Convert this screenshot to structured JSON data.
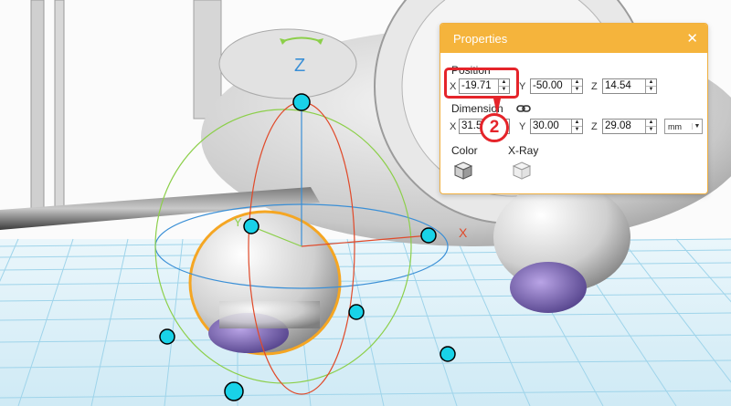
{
  "viewport": {
    "axis_labels": {
      "z": "Z",
      "x": "X",
      "y": "Y"
    }
  },
  "properties_panel": {
    "title": "Properties",
    "close_icon": "close-icon",
    "position": {
      "label": "Position",
      "x_label": "X",
      "x_value": "-19.71",
      "y_label": "Y",
      "y_value": "-50.00",
      "z_label": "Z",
      "z_value": "14.54"
    },
    "dimension": {
      "label": "Dimension",
      "link_icon": "link-icon",
      "x_label": "X",
      "x_value": "31.5",
      "y_label": "Y",
      "y_value": "30.00",
      "z_label": "Z",
      "z_value": "29.08",
      "unit": "mm"
    },
    "color_label": "Color",
    "xray_label": "X-Ray"
  },
  "annotation": {
    "step_number": "2",
    "accent": "#e5242a"
  },
  "colors": {
    "panel_header": "#f5b43c",
    "grid": "#9fd4ea",
    "handle": "#19d2e8"
  }
}
